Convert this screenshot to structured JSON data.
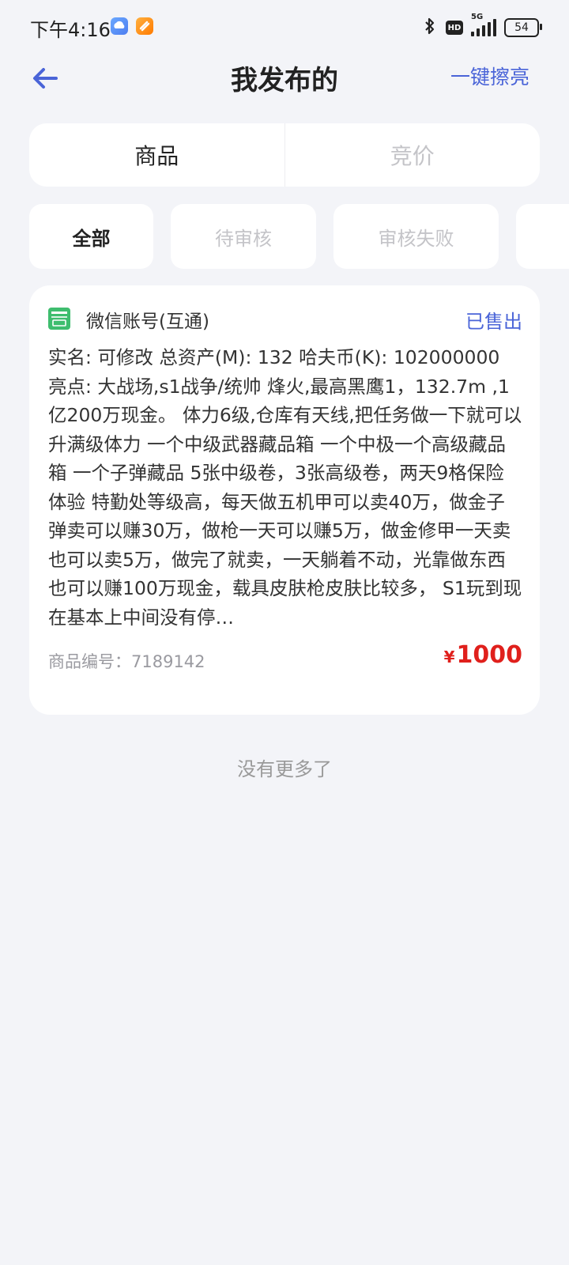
{
  "status_bar": {
    "time": "下午4:16",
    "network": "5G",
    "hd": "HD",
    "battery": "54"
  },
  "header": {
    "title": "我发布的",
    "action": "一键擦亮"
  },
  "segments": [
    {
      "label": "商品",
      "active": true
    },
    {
      "label": "竞价",
      "active": false
    }
  ],
  "filters": [
    {
      "label": "全部",
      "active": true
    },
    {
      "label": "待审核",
      "active": false
    },
    {
      "label": "审核失败",
      "active": false
    },
    {
      "label": "",
      "active": false
    }
  ],
  "listing": {
    "category": "微信账号(互通)",
    "status": "已售出",
    "line1": "实名: 可修改 总资产(M): 132 哈夫币(K): 102000000",
    "description": "亮点: 大战场,s1战争/统帅 烽火,最高黑鹰1，132.7m ,1亿200万现金。 体力6级,仓库有天线,把任务做一下就可以升满级体力 一个中级武器藏品箱 一个中极一个高级藏品箱 一个子弹藏品 5张中级卷，3张高级卷，两天9格保险体验 特勤处等级高，每天做五机甲可以卖40万，做金子弹卖可以赚30万，做枪一天可以赚5万，做金修甲一天卖也可以卖5万，做完了就卖，一天躺着不动，光靠做东西也可以赚100万现金，载具皮肤枪皮肤比较多， S1玩到现在基本上中间没有停…",
    "id_text": "商品编号：7189142",
    "currency": "¥",
    "price": "1000"
  },
  "footer_text": "没有更多了",
  "colors": {
    "accent": "#4a64d8",
    "price": "#e0201c",
    "background": "#f3f4f8"
  },
  "icons": {
    "back": "arrow-left-icon",
    "wechat": "wechat-account-icon",
    "bluetooth": "bluetooth-icon"
  }
}
